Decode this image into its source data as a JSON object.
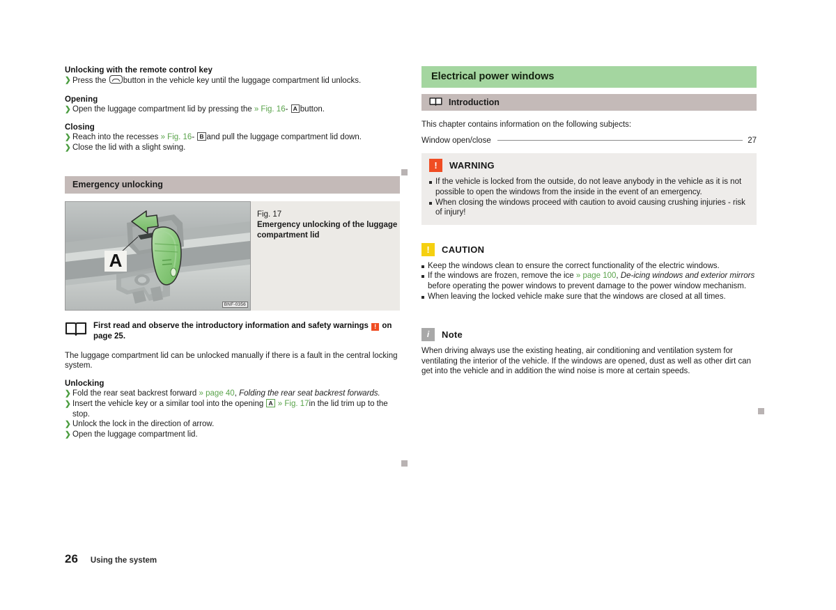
{
  "footer": {
    "page_number": "26",
    "section_title": "Using the system"
  },
  "left_column": {
    "remote": {
      "heading": "Unlocking with the remote control key",
      "step_prefix": "Press the",
      "step_suffix": "button in the vehicle key until the luggage compartment lid unlocks.",
      "icon": "trunk-button-icon"
    },
    "opening": {
      "heading": "Opening",
      "text_before": "Open the luggage compartment lid by pressing the",
      "xref": "» Fig. 16",
      "dash": "-",
      "boxref": "A",
      "text_after": "button."
    },
    "closing": {
      "heading": "Closing",
      "step1_before": "Reach into the recesses",
      "step1_xref": "» Fig. 16",
      "step1_dash": "-",
      "step1_boxref": "B",
      "step1_after": "and pull the luggage compartment lid down.",
      "step2": "Close the lid with a slight swing."
    },
    "emergency_bar": "Emergency unlocking",
    "figure": {
      "number": "Fig. 17",
      "title": "Emergency unlocking of the luggage compartment lid",
      "code": "BNF-0356",
      "callout_letter": "A"
    },
    "readfirst": {
      "before": "First read and observe the introductory information and safety warnings",
      "marker": "!",
      "after": "on page 25."
    },
    "intro_paragraph": "The luggage compartment lid can be unlocked manually if there is a fault in the central locking system.",
    "unlocking": {
      "heading": "Unlocking",
      "step1_before": "Fold the rear seat backrest forward",
      "step1_xref": "» page 40",
      "step1_comma": ",",
      "step1_italic": "Folding the rear seat backrest forwards.",
      "step2_before": "Insert the vehicle key or a similar tool into the opening",
      "step2_boxref": "A",
      "step2_xref": "» Fig. 17",
      "step2_after": "in the lid trim up to the stop.",
      "step3": "Unlock the lock in the direction of arrow.",
      "step4": "Open the luggage compartment lid."
    }
  },
  "right_column": {
    "chapter_title": "Electrical power windows",
    "introduction_bar": "Introduction",
    "intro_lead": "This chapter contains information on the following subjects:",
    "toc": {
      "label": "Window open/close",
      "page": "27"
    },
    "warning": {
      "label": "WARNING",
      "icon": "warning-icon",
      "color": "#f04d23",
      "items": [
        "If the vehicle is locked from the outside, do not leave anybody in the vehicle as it is not possible to open the windows from the inside in the event of an emergency.",
        "When closing the windows proceed with caution to avoid causing crushing injuries - risk of injury!"
      ]
    },
    "caution": {
      "label": "CAUTION",
      "icon": "caution-icon",
      "color": "#f5d010",
      "item1_before": "Keep the windows clean to ensure the correct functionality of the electric windows.",
      "item2_before": "If the windows are frozen, remove the ice",
      "item2_xref": "» page 100",
      "item2_comma": ",",
      "item2_italic": "De-icing windows and exterior mirrors",
      "item2_after": "before operating the power windows to prevent damage to the power window mechanism.",
      "item3": "When leaving the locked vehicle make sure that the windows are closed at all times."
    },
    "note": {
      "label": "Note",
      "icon": "info-icon",
      "color": "#a8a8a8",
      "text": "When driving always use the existing heating, air conditioning and ventilation system for ventilating the interior of the vehicle. If the windows are opened, dust as well as other dirt can get into the vehicle and in addition the wind noise is more at certain speeds."
    }
  }
}
